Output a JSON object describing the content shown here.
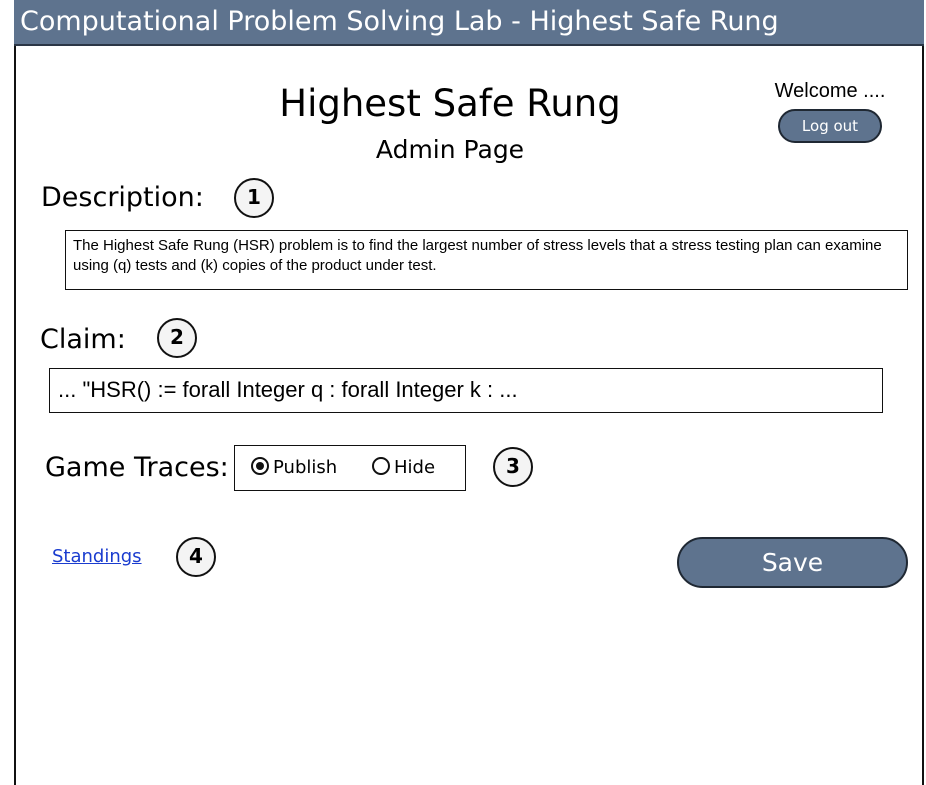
{
  "window": {
    "title": "Computational Problem Solving Lab - Highest Safe Rung"
  },
  "header": {
    "title": "Highest Safe Rung",
    "subtitle": "Admin Page",
    "welcome": "Welcome ....",
    "logout_label": "Log out"
  },
  "description": {
    "label": "Description:",
    "badge": "1",
    "text": "The Highest Safe Rung (HSR) problem is to find the largest number of stress levels that a stress testing plan can examine using (q) tests and (k) copies of the product under test."
  },
  "claim": {
    "label": "Claim:",
    "badge": "2",
    "value": "... \"HSR() := forall Integer q : forall Integer k : ..."
  },
  "game_traces": {
    "label": "Game Traces:",
    "badge": "3",
    "options": [
      {
        "label": "Publish",
        "selected": true
      },
      {
        "label": "Hide",
        "selected": false
      }
    ]
  },
  "footer": {
    "standings_label": "Standings",
    "standings_badge": "4",
    "save_label": "Save"
  },
  "colors": {
    "accent": "#5e738e",
    "link": "#1a3ccf"
  }
}
